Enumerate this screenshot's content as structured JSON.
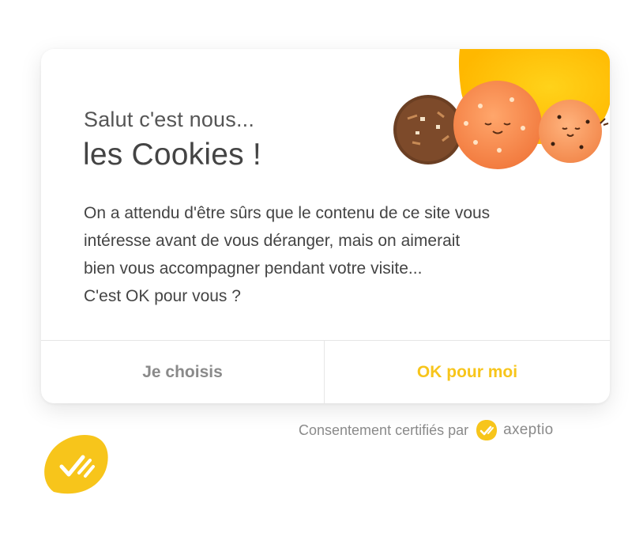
{
  "dialog": {
    "greeting": "Salut c'est nous...",
    "title": "les Cookies !",
    "body_lines": [
      "On a attendu d'être sûrs que le contenu de ce site vous",
      "intéresse avant de vous déranger, mais on aimerait",
      "bien vous accompagner pendant votre visite...",
      "C'est OK pour vous ?"
    ],
    "buttons": {
      "choose_label": "Je choisis",
      "accept_label": "OK pour moi"
    }
  },
  "footer": {
    "consent_text": "Consentement certifiés par",
    "brand_name": "axeptio"
  },
  "icons": {
    "illustration": "cookies-illustration",
    "badge": "axeptio-check-icon",
    "fab": "axeptio-fab-icon"
  },
  "colors": {
    "accent": "#f7c51b",
    "sun": "#ffc300",
    "text": "#444444",
    "muted": "#8a8a8a"
  }
}
